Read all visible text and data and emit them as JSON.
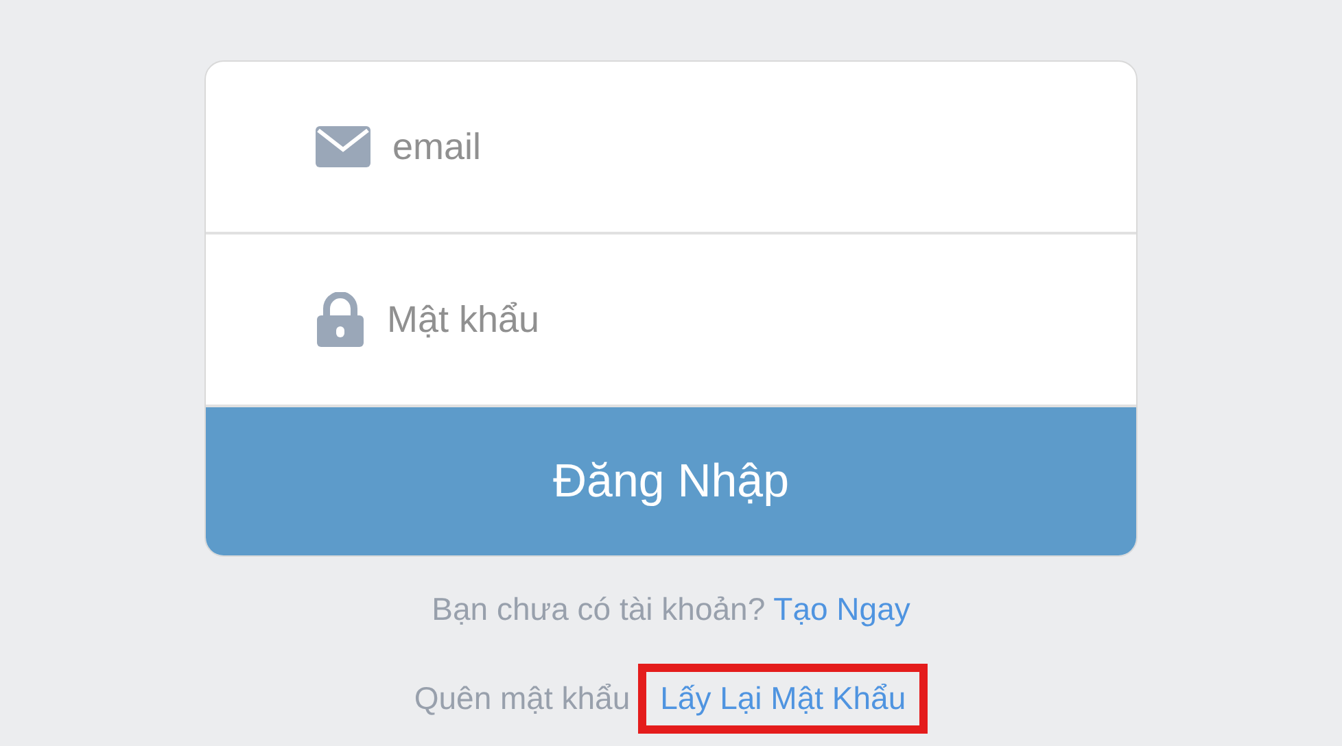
{
  "form": {
    "fields": [
      {
        "kind": "email",
        "placeholder": "email"
      },
      {
        "kind": "password",
        "placeholder": "Mật khẩu"
      }
    ],
    "submit": "Đăng Nhập"
  },
  "footer": [
    {
      "text": "Bạn chưa có tài khoản?",
      "link": "Tạo Ngay",
      "highlighted": false
    },
    {
      "text": "Quên mật khẩu",
      "link": "Lấy Lại Mật Khẩu",
      "highlighted": true
    }
  ]
}
